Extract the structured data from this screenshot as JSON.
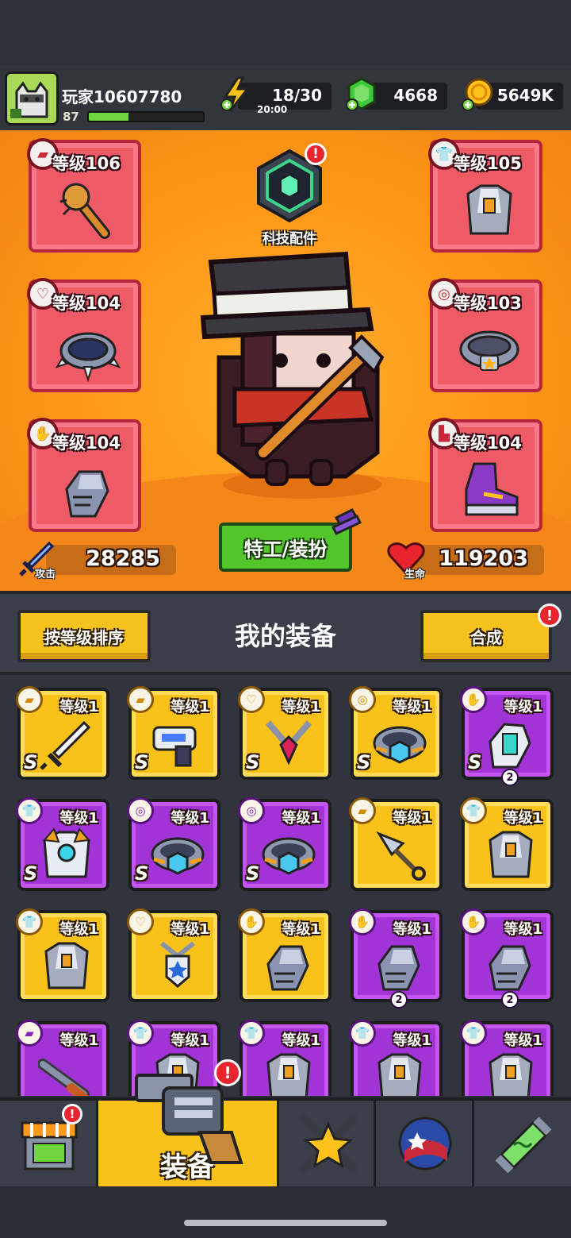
{
  "player": {
    "name": "玩家10607780",
    "level": "87",
    "xp_fraction": 0.35
  },
  "resources": {
    "energy": {
      "value": "18/30",
      "timer": "20:00",
      "icon": "lightning-icon"
    },
    "gems": {
      "value": "4668",
      "icon": "green-gem-icon"
    },
    "coins": {
      "value": "5649K",
      "icon": "gold-coin-icon"
    }
  },
  "equipped": {
    "weapon": {
      "level": "等级106",
      "type_icon": "gun-type-icon",
      "item_icon": "spiked-bat-icon"
    },
    "armor": {
      "level": "等级105",
      "type_icon": "shirt-type-icon",
      "item_icon": "chest-armor-icon"
    },
    "necklace": {
      "level": "等级104",
      "type_icon": "necklace-type-icon",
      "item_icon": "spiked-collar-icon"
    },
    "belt": {
      "level": "等级103",
      "type_icon": "belt-type-icon",
      "item_icon": "star-belt-icon"
    },
    "gloves": {
      "level": "等级104",
      "type_icon": "glove-type-icon",
      "item_icon": "metal-gauntlet-icon"
    },
    "boots": {
      "level": "等级104",
      "type_icon": "boot-type-icon",
      "item_icon": "purple-sneaker-icon"
    }
  },
  "tech": {
    "label": "科技配件",
    "badge": "!"
  },
  "agent_button": "特工/装扮",
  "stats": {
    "attack_label": "攻击",
    "attack": "28285",
    "hp_label": "生命",
    "hp": "119203"
  },
  "equipment_section": {
    "sort_label": "按等级排序",
    "title": "我的装备",
    "merge_label": "合成",
    "merge_badge": "!"
  },
  "inventory": [
    {
      "rarity": "gold",
      "type": "gun",
      "level": "等级1",
      "rank": "S",
      "icon": "sword-icon",
      "count": ""
    },
    {
      "rarity": "gold",
      "type": "gun",
      "level": "等级1",
      "rank": "S",
      "icon": "laser-gun-icon",
      "count": ""
    },
    {
      "rarity": "gold",
      "type": "necklace",
      "level": "等级1",
      "rank": "S",
      "icon": "chain-necklace-icon",
      "count": ""
    },
    {
      "rarity": "gold",
      "type": "belt",
      "level": "等级1",
      "rank": "S",
      "icon": "hex-belt-icon",
      "count": ""
    },
    {
      "rarity": "purple",
      "type": "glove",
      "level": "等级1",
      "rank": "S",
      "icon": "tech-gauntlet-icon",
      "count": "2"
    },
    {
      "rarity": "purple",
      "type": "shirt",
      "level": "等级1",
      "rank": "S",
      "icon": "mech-armor-icon",
      "count": ""
    },
    {
      "rarity": "purple",
      "type": "belt",
      "level": "等级1",
      "rank": "S",
      "icon": "hex-belt-icon",
      "count": ""
    },
    {
      "rarity": "purple",
      "type": "belt",
      "level": "等级1",
      "rank": "S",
      "icon": "hex-belt-icon",
      "count": ""
    },
    {
      "rarity": "gold",
      "type": "gun",
      "level": "等级1",
      "rank": "",
      "icon": "kunai-icon",
      "count": ""
    },
    {
      "rarity": "gold",
      "type": "shirt",
      "level": "等级1",
      "rank": "",
      "icon": "chest-armor-icon",
      "count": ""
    },
    {
      "rarity": "gold",
      "type": "shirt",
      "level": "等级1",
      "rank": "",
      "icon": "chest-armor-icon",
      "count": ""
    },
    {
      "rarity": "gold",
      "type": "necklace",
      "level": "等级1",
      "rank": "",
      "icon": "star-badge-necklace-icon",
      "count": ""
    },
    {
      "rarity": "gold",
      "type": "glove",
      "level": "等级1",
      "rank": "",
      "icon": "metal-gauntlet-icon",
      "count": ""
    },
    {
      "rarity": "purple",
      "type": "glove",
      "level": "等级1",
      "rank": "",
      "icon": "metal-gauntlet-icon",
      "count": "2"
    },
    {
      "rarity": "purple",
      "type": "glove",
      "level": "等级1",
      "rank": "",
      "icon": "metal-gauntlet-icon",
      "count": "2"
    },
    {
      "rarity": "purple",
      "type": "gun",
      "level": "等级1",
      "rank": "",
      "icon": "shotgun-icon",
      "count": ""
    },
    {
      "rarity": "purple",
      "type": "shirt",
      "level": "等级1",
      "rank": "",
      "icon": "chest-armor-icon",
      "count": ""
    },
    {
      "rarity": "purple",
      "type": "shirt",
      "level": "等级1",
      "rank": "",
      "icon": "chest-armor-icon",
      "count": ""
    },
    {
      "rarity": "purple",
      "type": "shirt",
      "level": "等级1",
      "rank": "",
      "icon": "chest-armor-icon",
      "count": ""
    },
    {
      "rarity": "purple",
      "type": "shirt",
      "level": "等级1",
      "rank": "",
      "icon": "chest-armor-icon",
      "count": ""
    }
  ],
  "nav": {
    "shop": {
      "icon": "shop-stall-icon",
      "badge": "!"
    },
    "equipment": {
      "label": "装备",
      "icon": "revolver-icon",
      "badge": "!"
    },
    "talents": {
      "icon": "crossed-swords-star-icon"
    },
    "skills": {
      "icon": "star-orb-icon"
    },
    "lab": {
      "icon": "dna-capsule-icon"
    }
  },
  "colors": {
    "accent_orange": "#ff9a1a",
    "equip_slot_red": "#ee5a66",
    "rarity_gold": "#f8c21a",
    "rarity_purple": "#a233d6",
    "button_green": "#52c62a",
    "alert_red": "#e8242f"
  }
}
